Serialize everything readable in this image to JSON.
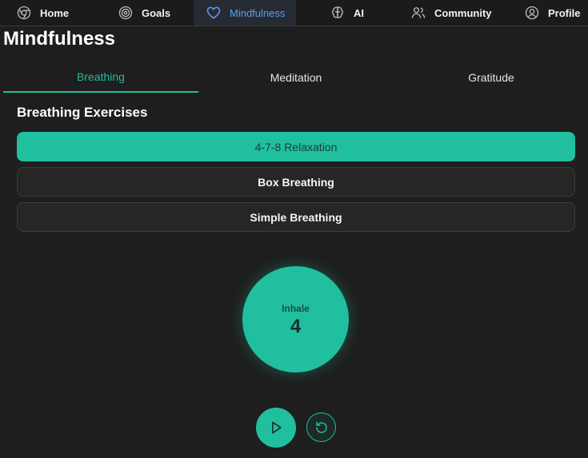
{
  "nav": {
    "items": [
      {
        "label": "Home",
        "icon": "chrome-circle-icon"
      },
      {
        "label": "Goals",
        "icon": "target-icon"
      },
      {
        "label": "Mindfulness",
        "icon": "heart-icon",
        "active": true
      },
      {
        "label": "AI",
        "icon": "brain-icon"
      },
      {
        "label": "Community",
        "icon": "users-icon"
      },
      {
        "label": "Profile",
        "icon": "user-circle-icon"
      }
    ],
    "active_color": "#5b9cf2"
  },
  "page": {
    "title": "Mindfulness"
  },
  "tabs": [
    {
      "label": "Breathing",
      "active": true
    },
    {
      "label": "Meditation"
    },
    {
      "label": "Gratitude"
    }
  ],
  "breathing": {
    "section_title": "Breathing Exercises",
    "exercises": [
      {
        "label": "4-7-8 Relaxation",
        "selected": true
      },
      {
        "label": "Box Breathing"
      },
      {
        "label": "Simple Breathing"
      }
    ],
    "phase": "Inhale",
    "count": "4",
    "controls": {
      "play_icon": "play-icon",
      "reset_icon": "reset-icon"
    }
  },
  "colors": {
    "accent": "#1fbf9f",
    "background": "#1e1e1e"
  }
}
